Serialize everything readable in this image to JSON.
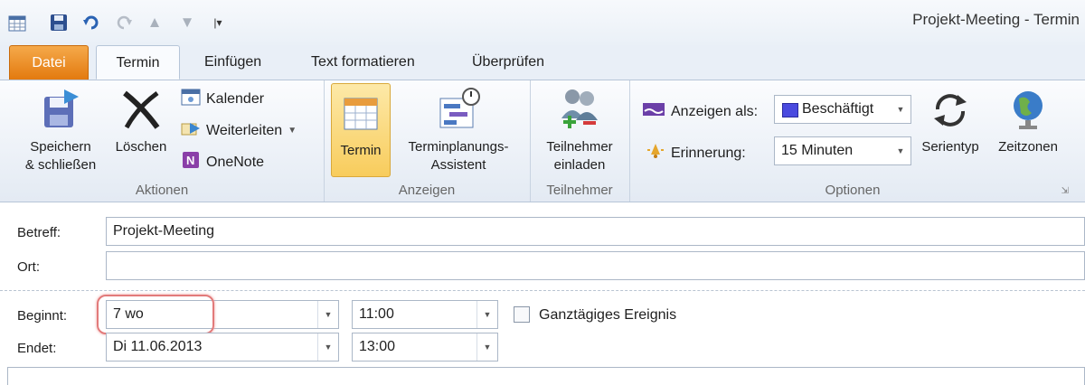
{
  "window": {
    "title": "Projekt-Meeting  -  Termin"
  },
  "qat": {
    "icons": [
      "calendar-app-icon",
      "save-icon",
      "undo-icon",
      "redo-icon",
      "previous-item-icon",
      "next-item-icon",
      "customize-qat-icon"
    ]
  },
  "tabs": [
    "Datei",
    "Termin",
    "Einfügen",
    "Text formatieren",
    "Überprüfen"
  ],
  "ribbon": {
    "aktionen": {
      "label": "Aktionen",
      "save_close": [
        "Speichern",
        "& schließen"
      ],
      "delete": "Löschen",
      "calendar": "Kalender",
      "forward": "Weiterleiten",
      "onenote": "OneNote"
    },
    "anzeigen": {
      "label": "Anzeigen",
      "termin": "Termin",
      "assistant": [
        "Terminplanungs-",
        "Assistent"
      ]
    },
    "teilnehmer": {
      "label": "Teilnehmer",
      "invite": [
        "Teilnehmer",
        "einladen"
      ]
    },
    "optionen": {
      "label": "Optionen",
      "show_as_label": "Anzeigen als:",
      "show_as_value": "Beschäftigt",
      "reminder_label": "Erinnerung:",
      "reminder_value": "15 Minuten",
      "recurrence": "Serientyp",
      "timezones": "Zeitzonen"
    }
  },
  "form": {
    "subject_label": "Betreff:",
    "subject_value": "Projekt-Meeting",
    "location_label": "Ort:",
    "location_value": "",
    "start_label": "Beginnt:",
    "start_date": "7 wo",
    "start_time": "11:00",
    "allday_label": "Ganztägiges Ereignis",
    "end_label": "Endet:",
    "end_date": "Di 11.06.2013",
    "end_time": "13:00"
  },
  "colors": {
    "file_tab": "#e37a0f",
    "highlight": "#d9534f",
    "busy": "#4a4adf",
    "active_button": "#fbd87b"
  }
}
